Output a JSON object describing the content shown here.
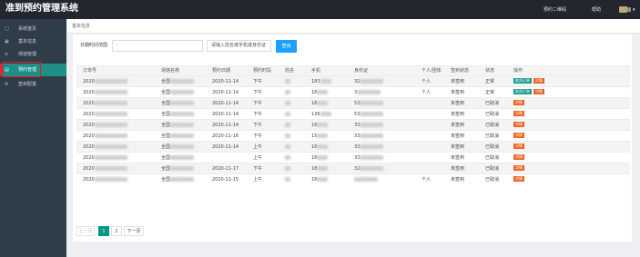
{
  "app": {
    "title": "准到预约管理系统"
  },
  "topbar": {
    "qr_label": "预约二维码",
    "help_label": "帮助"
  },
  "sidebar": {
    "items": [
      {
        "label": "系统首页",
        "icon": "□"
      },
      {
        "label": "基本信息",
        "icon": "▣"
      },
      {
        "label": "场馆管理",
        "icon": "≡"
      },
      {
        "label": "预约管理",
        "icon": "▤"
      },
      {
        "label": "签到配置",
        "icon": "⚙"
      }
    ]
  },
  "breadcrumb": "基本信息",
  "filter": {
    "date_label": "日期时间范围",
    "date_value": "-",
    "search_placeholder": "请输入姓名或手机或身份证",
    "query_label": "查询"
  },
  "table": {
    "headers": [
      "订单号",
      "场馆名称",
      "预约日期",
      "预约时段",
      "姓名",
      "手机",
      "身份证",
      "个人/团体",
      "签到状态",
      "状态",
      "操作"
    ],
    "rows": [
      {
        "order": "2020",
        "venue": "全国",
        "date": "2020-11-14",
        "slot": "下午",
        "phone": "183",
        "id": "32",
        "type": "个人",
        "checkin": "未签到",
        "status": "正常",
        "cancel": true
      },
      {
        "order": "2020",
        "venue": "全国",
        "date": "2020-11-14",
        "slot": "下午",
        "phone": "18",
        "id": "3",
        "type": "个人",
        "checkin": "未签到",
        "status": "正常",
        "cancel": true
      },
      {
        "order": "2020",
        "venue": "全国",
        "date": "2020-11-14",
        "slot": "下午",
        "phone": "18",
        "id": "53",
        "type": "",
        "checkin": "未签到",
        "status": "已取消",
        "cancel": false
      },
      {
        "order": "2020",
        "venue": "全国",
        "date": "2020-11-14",
        "slot": "下午",
        "phone": "136",
        "id": "53",
        "type": "",
        "checkin": "未签到",
        "status": "已取消",
        "cancel": false
      },
      {
        "order": "2020",
        "venue": "全国",
        "date": "2020-11-14",
        "slot": "下午",
        "phone": "18",
        "id": "33",
        "type": "",
        "checkin": "未签到",
        "status": "已取消",
        "cancel": false
      },
      {
        "order": "2020",
        "venue": "全国",
        "date": "2020-11-16",
        "slot": "下午",
        "phone": "15",
        "id": "33",
        "type": "",
        "checkin": "未签到",
        "status": "已取消",
        "cancel": false
      },
      {
        "order": "2020",
        "venue": "全国",
        "date": "2020-11-14",
        "slot": "上午",
        "phone": "18",
        "id": "33",
        "type": "",
        "checkin": "未签到",
        "status": "已取消",
        "cancel": false
      },
      {
        "order": "2020",
        "venue": "全国",
        "date": "",
        "slot": "上午",
        "phone": "18",
        "id": "33",
        "type": "",
        "checkin": "未签到",
        "status": "已取消",
        "cancel": false
      },
      {
        "order": "2020",
        "venue": "全国",
        "date": "2020-11-17",
        "slot": "下午",
        "phone": "18",
        "id": "32",
        "type": "",
        "checkin": "未签到",
        "status": "已取消",
        "cancel": false
      },
      {
        "order": "2020",
        "venue": "全国",
        "date": "2020-11-15",
        "slot": "上午",
        "phone": "18",
        "id": "",
        "type": "个人",
        "checkin": "未签到",
        "status": "已取消",
        "cancel": false
      }
    ],
    "cancel_label": "取消订单",
    "detail_label": "详情"
  },
  "pagination": {
    "prev": "上一页",
    "pages": [
      "1",
      "2"
    ],
    "next": "下一页"
  },
  "colors": {
    "topbar": "#23262e",
    "sidebar": "#2f3c4a",
    "accent": "#009688",
    "query": "#1e9fff",
    "detail": "#f0611f"
  }
}
